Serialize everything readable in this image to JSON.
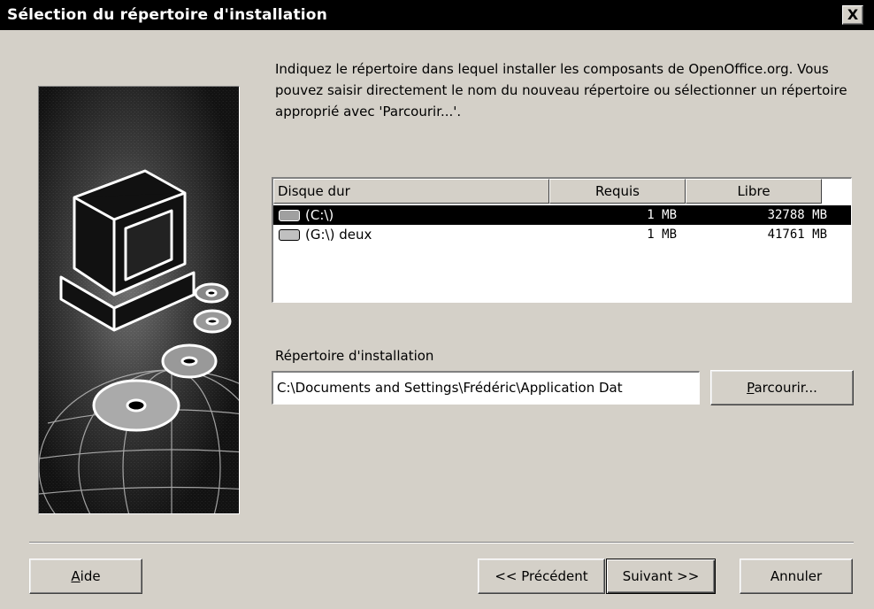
{
  "window": {
    "title": "Sélection du répertoire d'installation",
    "close_label": "X"
  },
  "intro_text": "Indiquez le répertoire dans lequel installer les composants de OpenOffice.org. Vous pouvez saisir directement le nom du nouveau répertoire ou sélectionner un répertoire approprié avec 'Parcourir...'.",
  "drive_list": {
    "columns": [
      "Disque dur",
      "Requis",
      "Libre"
    ],
    "rows": [
      {
        "drive": "(C:\\)",
        "required": "1 MB",
        "free": "32788 MB",
        "selected": true,
        "icon": "hard-drive-icon"
      },
      {
        "drive": "(G:\\)  deux",
        "required": "1 MB",
        "free": "41761 MB",
        "selected": false,
        "icon": "hard-drive-icon"
      }
    ]
  },
  "install_dir": {
    "label": "Répertoire d'installation",
    "value": "C:\\Documents and Settings\\Frédéric\\Application Dat"
  },
  "buttons": {
    "browse_accel": "P",
    "browse_rest": "arcourir...",
    "help_accel": "A",
    "help_rest": "ide",
    "previous": "<< Précédent",
    "next": "Suivant >>",
    "cancel": "Annuler"
  },
  "colors": {
    "dialog_bg": "#d4d0c8",
    "titlebar_bg": "#000000",
    "selection_bg": "#000000"
  }
}
